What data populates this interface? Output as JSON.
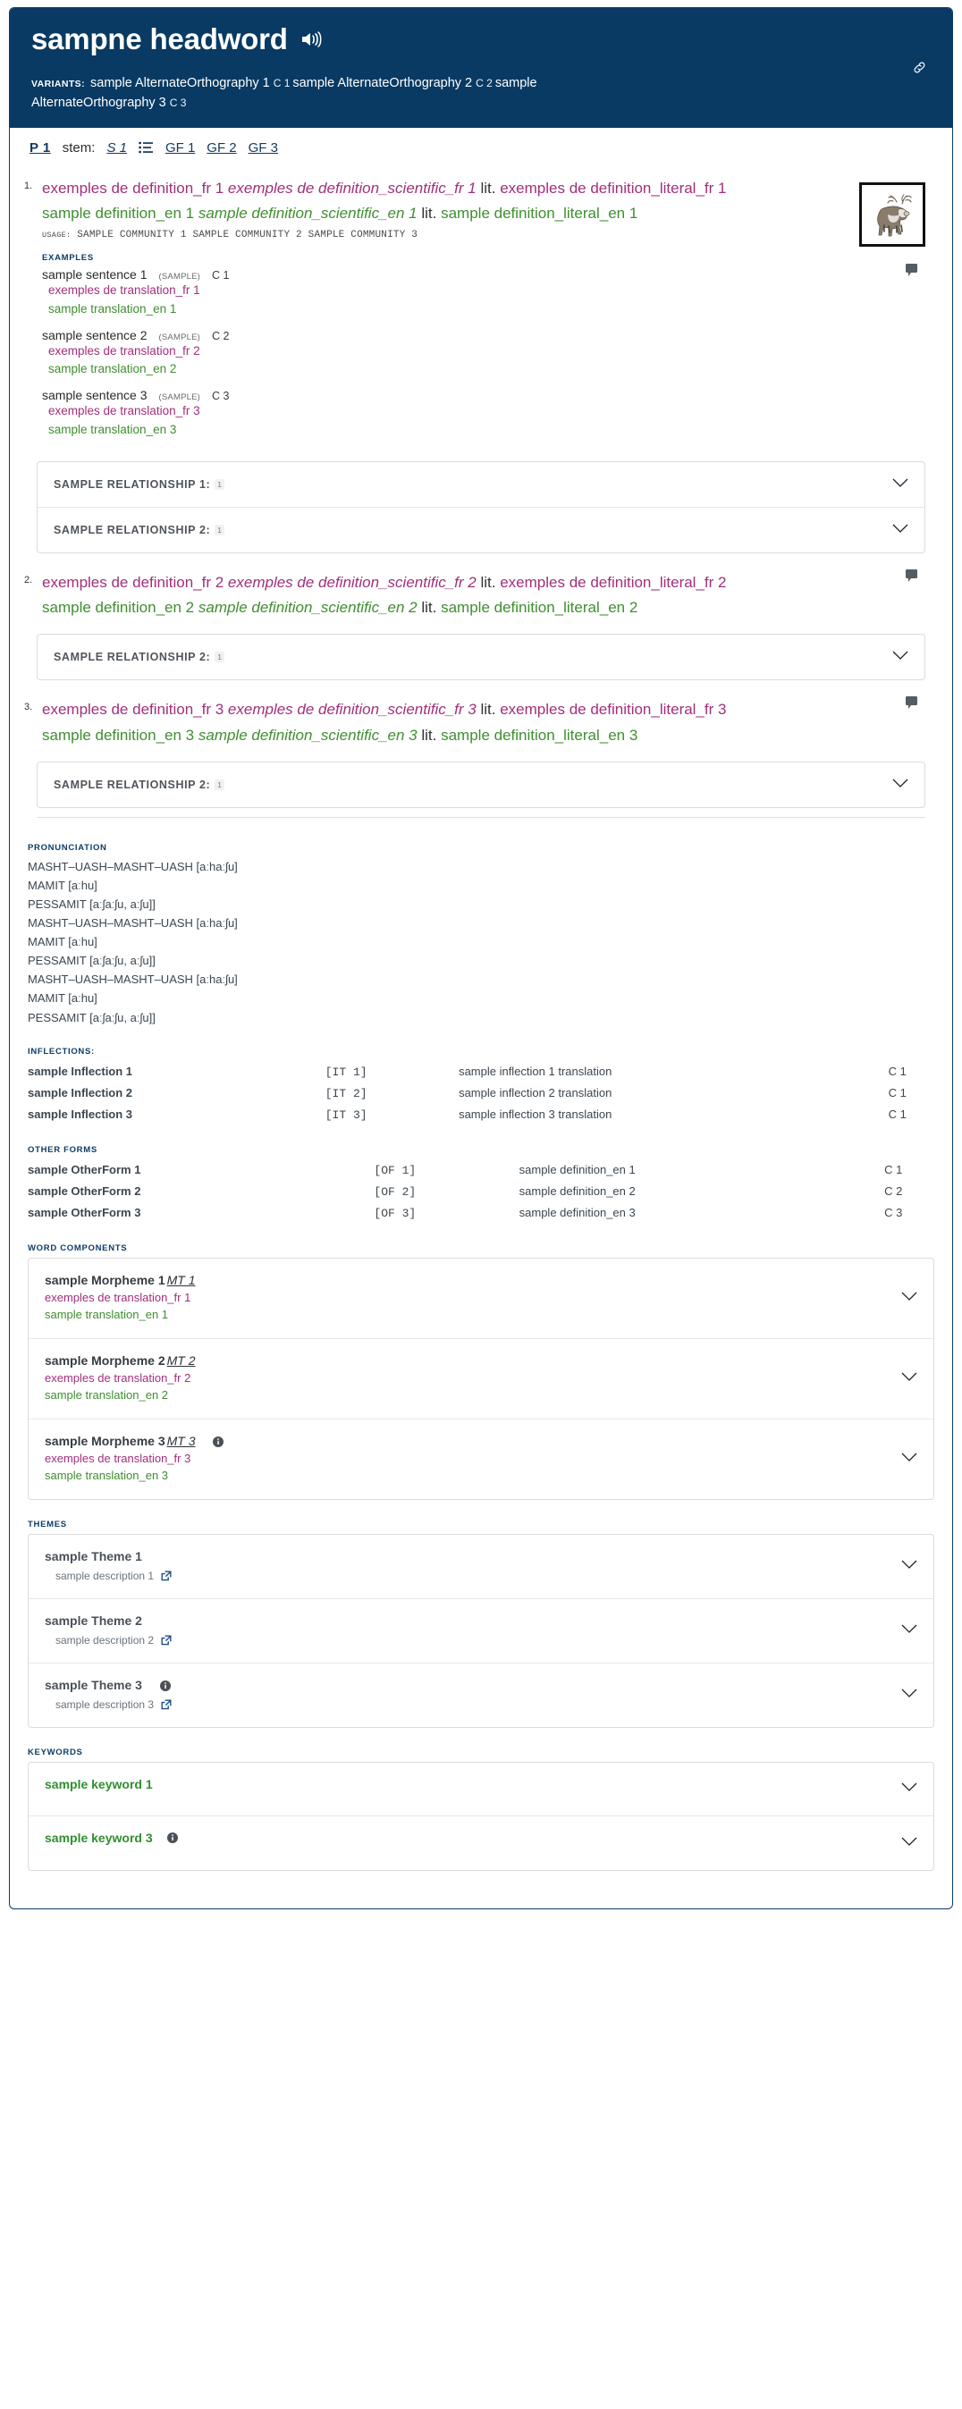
{
  "header": {
    "headword": "sampne headword",
    "audio_icon": "speaker-icon",
    "link_icon": "link-icon",
    "variants_label": "VARIANTS:",
    "variants": [
      {
        "text": "sample AlternateOrthography 1",
        "code": "C 1"
      },
      {
        "text": "sample AlternateOrthography 2",
        "code": "C 2"
      },
      {
        "text": "sample AlternateOrthography 3",
        "code": "C 3"
      }
    ]
  },
  "gram_bar": {
    "pos": "P 1",
    "stem_label": "stem:",
    "stem_value": "S 1",
    "list_icon": "list-icon",
    "grammatical_forms": [
      "GF 1",
      "GF 2",
      "GF 3"
    ]
  },
  "senses": [
    {
      "number": "1.",
      "def_fr_main": "exemples de definition_fr 1",
      "def_fr_sci": "exemples de definition_scientific_fr 1",
      "def_fr_lit_prefix": "lit.",
      "def_fr_lit": "exemples de definition_literal_fr 1",
      "def_en_main": "sample definition_en 1",
      "def_en_sci": "sample definition_scientific_en 1",
      "def_en_lit_prefix": "lit.",
      "def_en_lit": "sample definition_literal_en 1",
      "usage_label": "USAGE:",
      "usage_value": "SAMPLE COMMUNITY 1 SAMPLE COMMUNITY 2 SAMPLE COMMUNITY 3",
      "examples_label": "EXAMPLES",
      "examples": [
        {
          "sentence": "sample sentence 1",
          "tag": "(SAMPLE)",
          "code": "C 1",
          "fr": "exemples de translation_fr 1",
          "en": "sample translation_en 1"
        },
        {
          "sentence": "sample sentence 2",
          "tag": "(SAMPLE)",
          "code": "C 2",
          "fr": "exemples de translation_fr 2",
          "en": "sample translation_en 2"
        },
        {
          "sentence": "sample sentence 3",
          "tag": "(SAMPLE)",
          "code": "C 3",
          "fr": "exemples de translation_fr 3",
          "en": "sample translation_en 3"
        }
      ],
      "relationships": [
        {
          "title": "SAMPLE RELATIONSHIP 1:",
          "badge": "1"
        },
        {
          "title": "SAMPLE RELATIONSHIP 2:",
          "badge": "1"
        }
      ],
      "has_image": true,
      "image_alt": "reindeer illustration"
    },
    {
      "number": "2.",
      "def_fr_main": "exemples de definition_fr 2",
      "def_fr_sci": "exemples de definition_scientific_fr 2",
      "def_fr_lit_prefix": "lit.",
      "def_fr_lit": "exemples de definition_literal_fr 2",
      "def_en_main": "sample definition_en 2",
      "def_en_sci": "sample definition_scientific_en 2",
      "def_en_lit_prefix": "lit.",
      "def_en_lit": "sample definition_literal_en 2",
      "relationships": [
        {
          "title": "SAMPLE RELATIONSHIP 2:",
          "badge": "1"
        }
      ],
      "has_image": false
    },
    {
      "number": "3.",
      "def_fr_main": "exemples de definition_fr 3",
      "def_fr_sci": "exemples de definition_scientific_fr 3",
      "def_fr_lit_prefix": "lit.",
      "def_fr_lit": "exemples de definition_literal_fr 3",
      "def_en_main": "sample definition_en 3",
      "def_en_sci": "sample definition_scientific_en 3",
      "def_en_lit_prefix": "lit.",
      "def_en_lit": "sample definition_literal_en 3",
      "relationships": [
        {
          "title": "SAMPLE RELATIONSHIP 2:",
          "badge": "1"
        }
      ],
      "has_image": false
    }
  ],
  "pronunciation": {
    "label": "PRONUNCIATION",
    "lines": [
      "MASHT–UASH–MASHT–UASH [aːhaːʃu]",
      "MAMIT [aːhu]",
      "PESSAMIT [aːʃaːʃu, aːʃu]]",
      "MASHT–UASH–MASHT–UASH [aːhaːʃu]",
      "MAMIT [aːhu]",
      "PESSAMIT [aːʃaːʃu, aːʃu]]",
      "MASHT–UASH–MASHT–UASH [aːhaːʃu]",
      "MAMIT [aːhu]",
      "PESSAMIT [aːʃaːʃu, aːʃu]]"
    ]
  },
  "inflections": {
    "label": "INFLECTIONS:",
    "rows": [
      {
        "name": "sample Inflection 1",
        "tag": "[IT 1]",
        "translation": "sample inflection 1 translation",
        "code": "C 1"
      },
      {
        "name": "sample Inflection 2",
        "tag": "[IT 2]",
        "translation": "sample inflection 2 translation",
        "code": "C 1"
      },
      {
        "name": "sample Inflection 3",
        "tag": "[IT 3]",
        "translation": "sample inflection 3 translation",
        "code": "C 1"
      }
    ]
  },
  "other_forms": {
    "label": "OTHER FORMS",
    "rows": [
      {
        "name": "sample OtherForm 1",
        "tag": "[OF 1]",
        "translation": "sample definition_en 1",
        "code": "C 1"
      },
      {
        "name": "sample OtherForm 2",
        "tag": "[OF 2]",
        "translation": "sample definition_en 2",
        "code": "C 2"
      },
      {
        "name": "sample OtherForm 3",
        "tag": "[OF 3]",
        "translation": "sample definition_en 3",
        "code": "C 3"
      }
    ]
  },
  "word_components": {
    "label": "WORD COMPONENTS",
    "items": [
      {
        "name": "sample Morpheme 1",
        "mt": "MT 1",
        "fr": "exemples de translation_fr 1",
        "en": "sample translation_en 1",
        "info": false
      },
      {
        "name": "sample Morpheme 2",
        "mt": "MT 2",
        "fr": "exemples de translation_fr 2",
        "en": "sample translation_en 2",
        "info": false
      },
      {
        "name": "sample Morpheme 3",
        "mt": "MT 3",
        "fr": "exemples de translation_fr 3",
        "en": "sample translation_en 3",
        "info": true
      }
    ]
  },
  "themes": {
    "label": "THEMES",
    "items": [
      {
        "name": "sample Theme 1",
        "description": "sample description 1",
        "info": false,
        "external_link": true
      },
      {
        "name": "sample Theme 2",
        "description": "sample description 2",
        "info": false,
        "external_link": true
      },
      {
        "name": "sample Theme 3",
        "description": "sample description 3",
        "info": true,
        "external_link": true
      }
    ]
  },
  "keywords": {
    "label": "KEYWORDS",
    "items": [
      {
        "name": "sample keyword 1",
        "info": false
      },
      {
        "name": "sample keyword 3",
        "info": true
      }
    ]
  },
  "colors": {
    "header_bg": "#083a63",
    "fr_text": "#a12f7b",
    "en_text": "#3f8e30",
    "label_blue": "#0d3c66",
    "keyword_green": "#2f8f2f"
  }
}
